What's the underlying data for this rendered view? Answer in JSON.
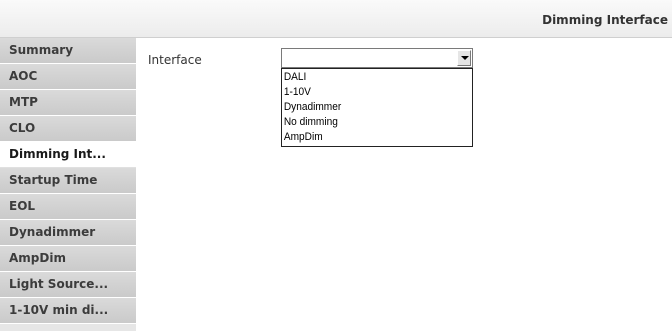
{
  "header": {
    "title": "Dimming Interface"
  },
  "sidebar": {
    "items": [
      {
        "label": "Summary"
      },
      {
        "label": "AOC"
      },
      {
        "label": "MTP"
      },
      {
        "label": "CLO"
      },
      {
        "label": "Dimming Int..."
      },
      {
        "label": "Startup Time"
      },
      {
        "label": "EOL"
      },
      {
        "label": "Dynadimmer"
      },
      {
        "label": "AmpDim"
      },
      {
        "label": "Light Source..."
      },
      {
        "label": "1-10V min di..."
      }
    ],
    "active_item": "Dimming Int..."
  },
  "form": {
    "interface_label": "Interface",
    "interface_value": "",
    "options": [
      "DALI",
      "1-10V",
      "Dynadimmer",
      "No dimming",
      "AmpDim"
    ]
  }
}
